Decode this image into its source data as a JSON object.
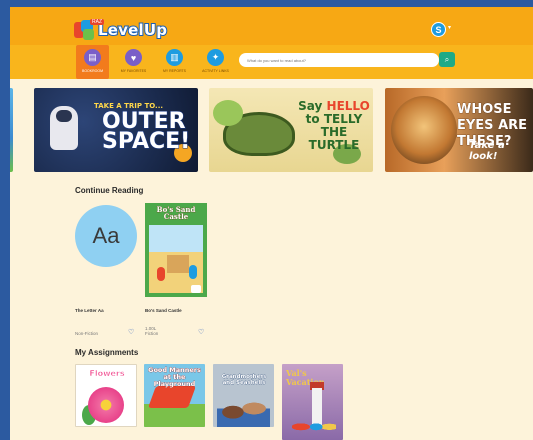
{
  "app": {
    "logo_text": "LevelUp",
    "logo_tag": "RAZ",
    "user_initial": "S",
    "user_caret": "▾"
  },
  "nav": {
    "items": [
      {
        "label": "Bookroom",
        "icon": "bookshelf-icon",
        "color": "#7a5fc8",
        "active": true
      },
      {
        "label": "My Favorites",
        "icon": "favorites-icon",
        "color": "#7a5fc8",
        "active": false
      },
      {
        "label": "My Reports",
        "icon": "reports-icon",
        "color": "#1e9ce0",
        "active": false
      },
      {
        "label": "Activity Links",
        "icon": "activity-icon",
        "color": "#1e9ce0",
        "active": false
      }
    ]
  },
  "search": {
    "placeholder": "What do you want to read about?",
    "button_icon": "search-icon"
  },
  "carousel": {
    "slides": [
      {
        "kicker": "TAKE A TRIP TO...",
        "title": "OUTER SPACE!"
      },
      {
        "title_pre": "Say ",
        "title_hl": "HELLO",
        "title_post": " to TELLY THE TURTLE"
      },
      {
        "title": "WHOSE EYES ARE THESE?",
        "subtitle": "Take a look!"
      }
    ]
  },
  "continue_reading": {
    "heading": "Continue Reading",
    "books": [
      {
        "cover_text": "Aa",
        "name": "The Letter Aa",
        "meta_line1": "",
        "meta_line2": "Non-Fiction"
      },
      {
        "cover_text": "Bo's Sand Castle",
        "name": "Bo's Sand Castle",
        "meta_line1": "1.00L",
        "meta_line2": "Fiction"
      }
    ]
  },
  "assignments": {
    "heading": "My Assignments",
    "books": [
      {
        "cover_title": "Flowers"
      },
      {
        "cover_title": "Good Manners at the Playground"
      },
      {
        "cover_title": "Grandmothers and Seashells"
      },
      {
        "cover_title": "Val's Vacation"
      }
    ]
  },
  "colors": {
    "header": "#f9b51c",
    "nav_active": "#f27b1c",
    "page_bg": "#fdf3da",
    "accent_green": "#1faa87",
    "heart": "#2a5fbf"
  }
}
